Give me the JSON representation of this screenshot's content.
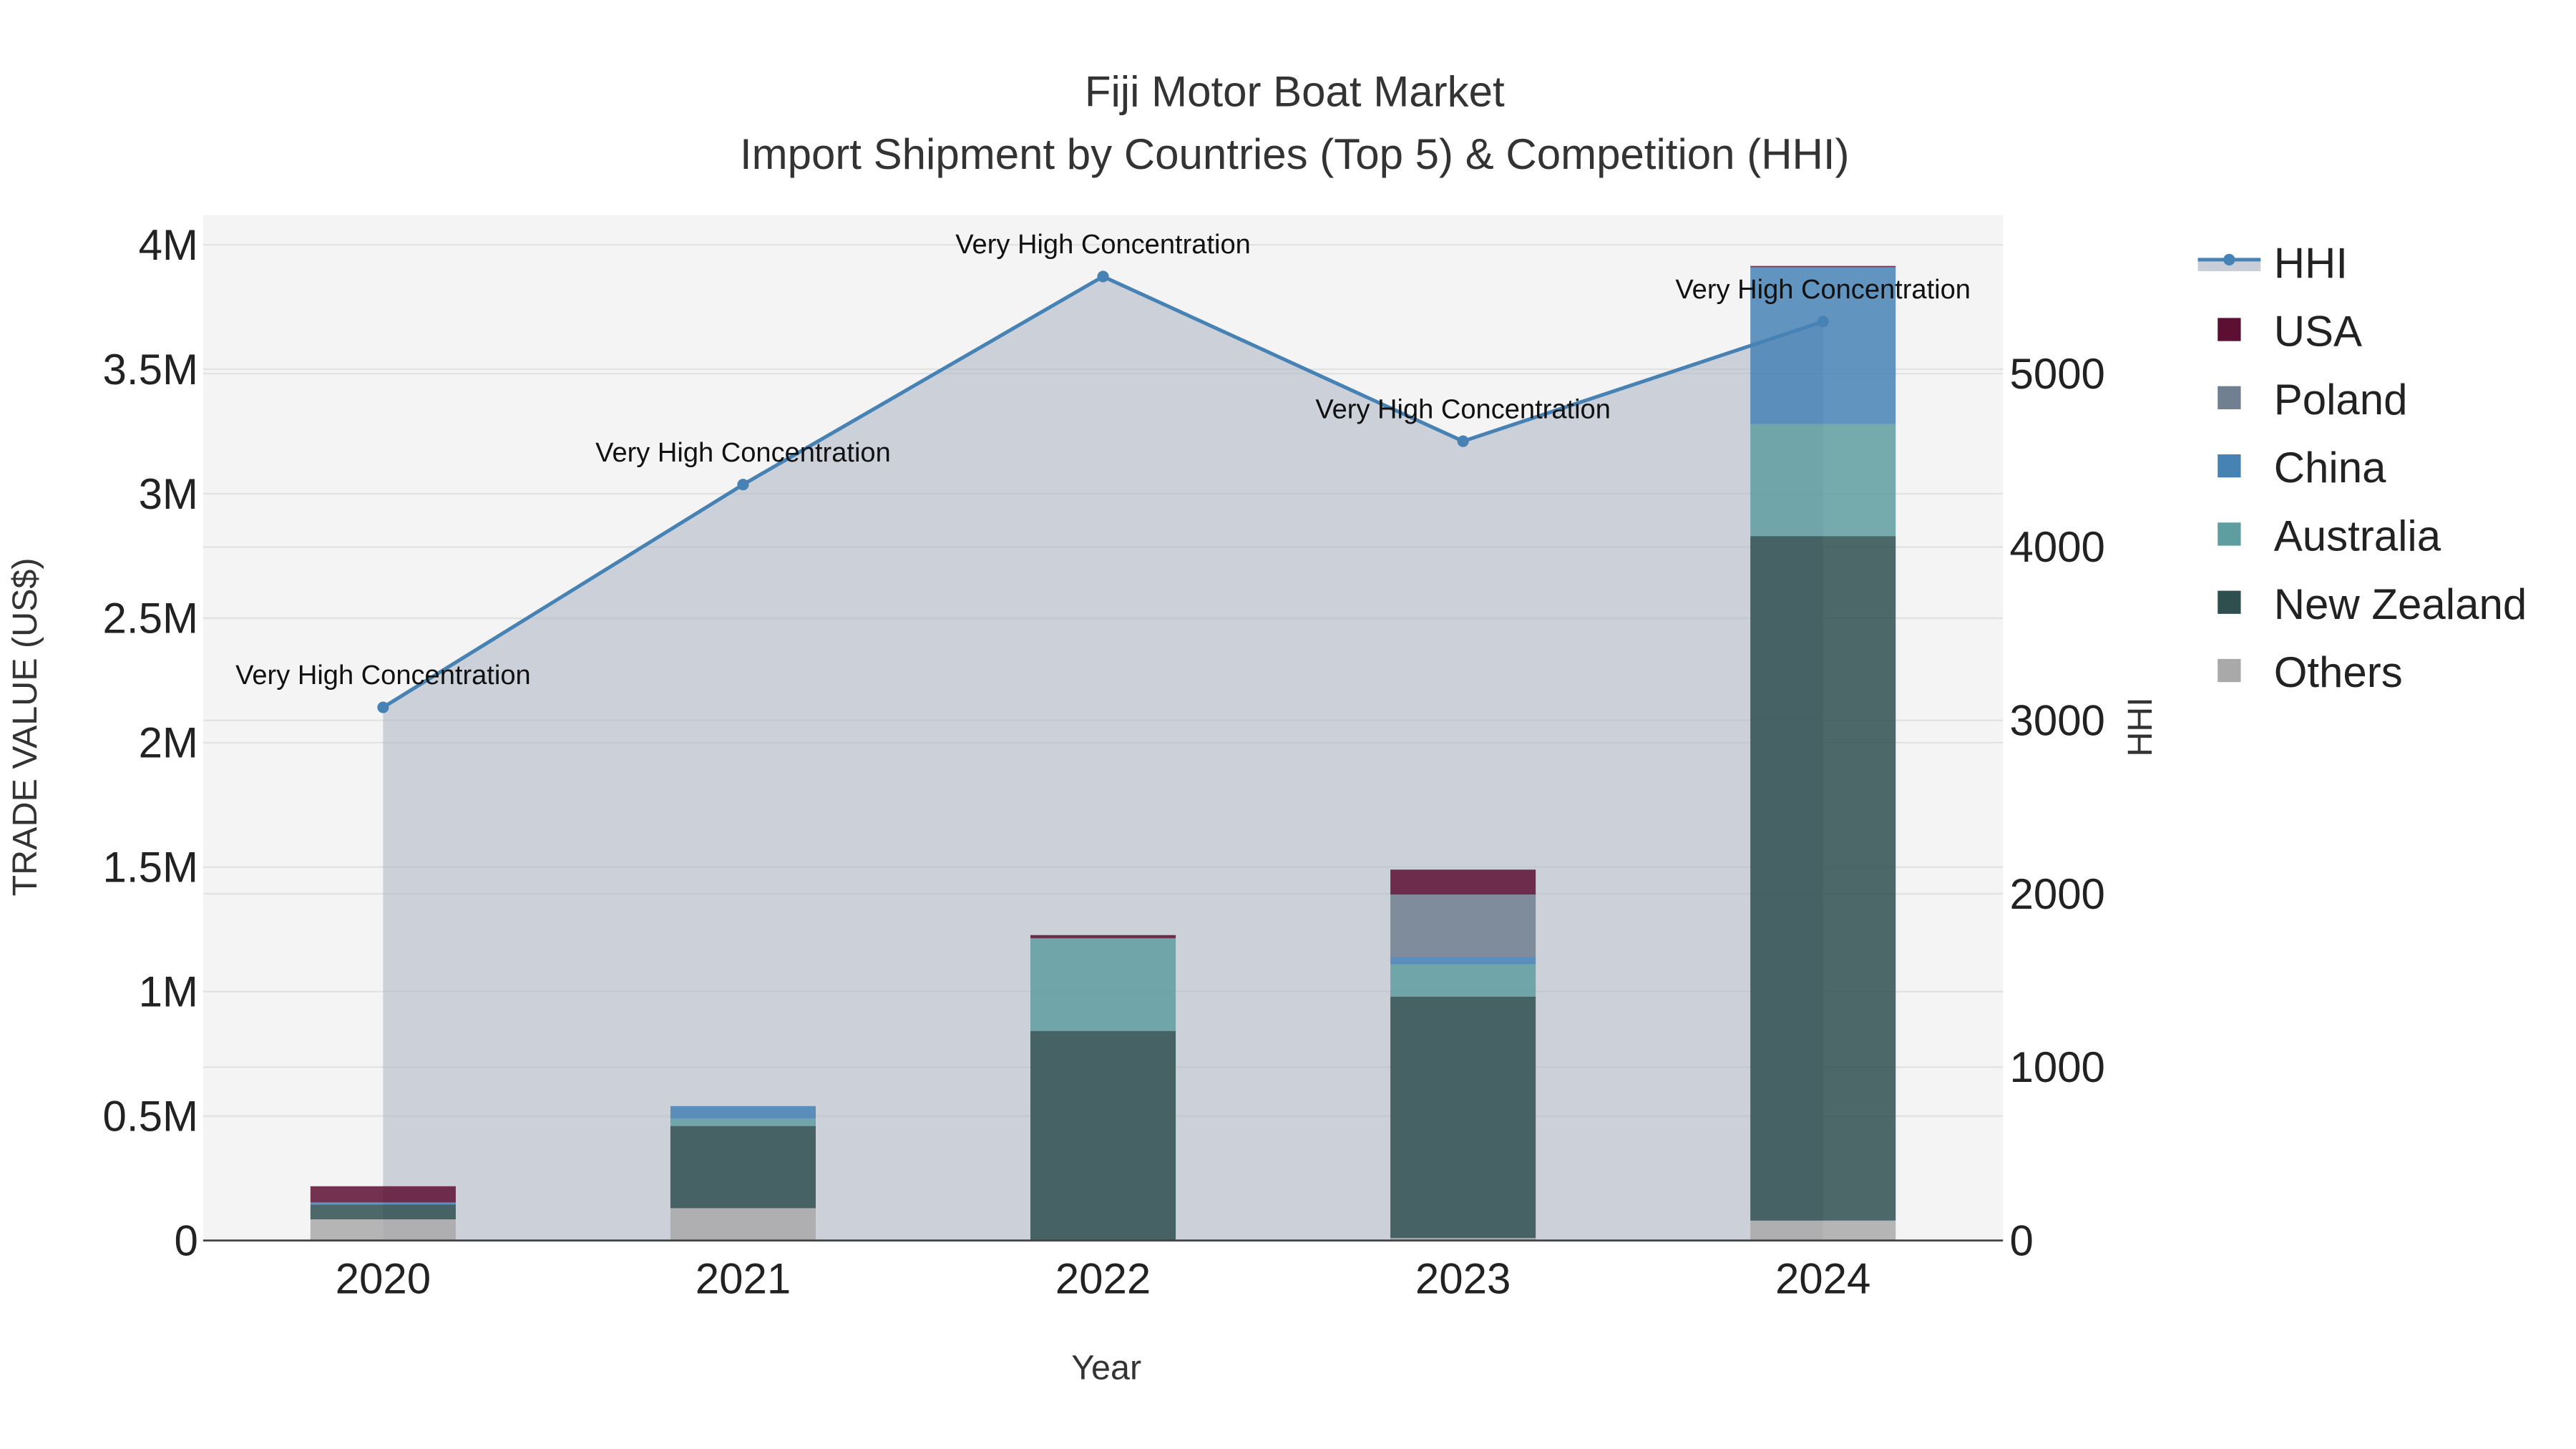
{
  "chart_data": {
    "type": "bar",
    "title": "Fiji Motor Boat Market",
    "subtitle": "Import Shipment by Countries (Top 5) & Competition (HHI)",
    "xlabel": "Year",
    "ylabel": "TRADE VALUE (US$)",
    "y2label": "HHI",
    "categories": [
      "2020",
      "2021",
      "2022",
      "2023",
      "2024"
    ],
    "ylim": [
      0,
      4000000
    ],
    "y2lim": [
      0,
      5000
    ],
    "yticks": [
      {
        "v": 0,
        "label": "0"
      },
      {
        "v": 500000,
        "label": "0.5M"
      },
      {
        "v": 1000000,
        "label": "1M"
      },
      {
        "v": 1500000,
        "label": "1.5M"
      },
      {
        "v": 2000000,
        "label": "2M"
      },
      {
        "v": 2500000,
        "label": "2.5M"
      },
      {
        "v": 3000000,
        "label": "3M"
      },
      {
        "v": 3500000,
        "label": "3.5M"
      },
      {
        "v": 4000000,
        "label": "4M"
      }
    ],
    "y2ticks": [
      {
        "v": 0,
        "label": "0"
      },
      {
        "v": 1000,
        "label": "1000"
      },
      {
        "v": 2000,
        "label": "2000"
      },
      {
        "v": 3000,
        "label": "3000"
      },
      {
        "v": 4000,
        "label": "4000"
      },
      {
        "v": 5000,
        "label": "5000"
      }
    ],
    "stack_order": [
      "Others",
      "New Zealand",
      "Australia",
      "China",
      "Poland",
      "USA"
    ],
    "series": [
      {
        "name": "USA",
        "color": "#5c0f33",
        "values": [
          65000,
          0,
          12000,
          100000,
          5000
        ]
      },
      {
        "name": "Poland",
        "color": "#708090",
        "values": [
          0,
          0,
          0,
          250000,
          0
        ]
      },
      {
        "name": "China",
        "color": "#4682b4",
        "values": [
          8000,
          50000,
          3000,
          30000,
          630000
        ]
      },
      {
        "name": "Australia",
        "color": "#5f9ea0",
        "values": [
          0,
          30000,
          370000,
          130000,
          450000
        ]
      },
      {
        "name": "New Zealand",
        "color": "#2f4f4f",
        "values": [
          60000,
          330000,
          840000,
          970000,
          2750000
        ]
      },
      {
        "name": "Others",
        "color": "#a9a9a9",
        "values": [
          85000,
          130000,
          2000,
          10000,
          80000
        ]
      }
    ],
    "hhi": {
      "name": "HHI",
      "color": "#4682b4",
      "values": [
        3075,
        4360,
        5560,
        4610,
        5300
      ],
      "annotations": [
        "Very High Concentration",
        "Very High Concentration",
        "Very High Concentration",
        "Very High Concentration",
        "Very High Concentration"
      ]
    },
    "legend_position": "right",
    "grid": true
  }
}
